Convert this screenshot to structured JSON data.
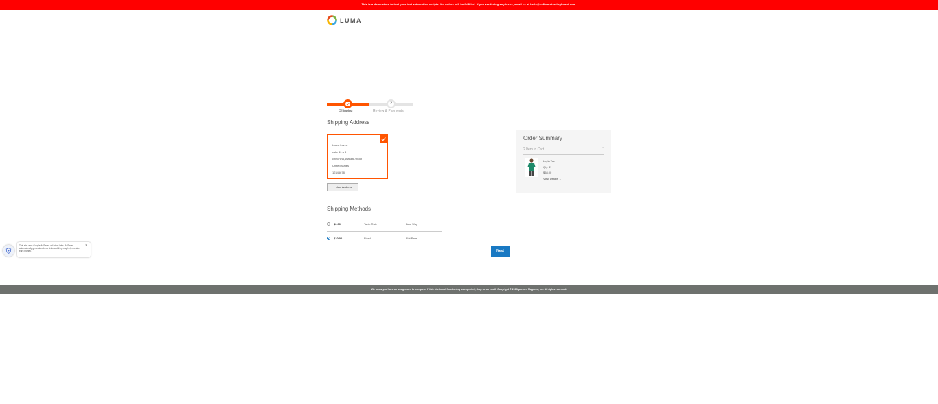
{
  "banner": {
    "text": "This is a demo store to test your test automation scripts. No orders will be fulfilled. If you are facing any issue, email us at hello@softwaretestingboard.com."
  },
  "logo": {
    "text": "LUMA",
    "icon": "luma-logo-icon"
  },
  "progress": {
    "steps": [
      {
        "label": "Shipping",
        "number": "1",
        "state": "complete"
      },
      {
        "label": "Review & Payments",
        "number": "2",
        "state": "pending"
      }
    ]
  },
  "shipping_address": {
    "title": "Shipping Address",
    "selected_address": {
      "name": "Laura Lozea",
      "street": "calle 11 a 3",
      "city_line": "chinchina, Alaska 78659",
      "country": "United States",
      "phone": "12345678"
    },
    "new_address_label": "+ New Address"
  },
  "shipping_methods": {
    "title": "Shipping Methods",
    "options": [
      {
        "price": "$0.00",
        "method": "Table Rate",
        "carrier": "Best Way",
        "selected": false
      },
      {
        "price": "$10.00",
        "method": "Fixed",
        "carrier": "Flat Rate",
        "selected": true
      }
    ]
  },
  "next_button": {
    "label": "Next"
  },
  "order_summary": {
    "title": "Order Summary",
    "items_count": "2 Item in Cart",
    "product": {
      "name": "Layla Tee",
      "qty": "Qty: 2",
      "price": "$58.00",
      "view_details": "View Details ⌄"
    }
  },
  "adsense": {
    "text": "This site uses Google AdSense ad intent links. AdSense automatically generates these links and they may help creators earn money.",
    "close": "×"
  },
  "footer": {
    "text": "We know you have an assignment to complete. If this site is not functioning as expected, drop us an email. Copyright © 2013-present Magento, Inc. All rights reserved."
  },
  "colors": {
    "accent": "#ff5501",
    "banner": "#ff0000",
    "primary_button": "#1979c3",
    "footer": "#6e716e"
  }
}
